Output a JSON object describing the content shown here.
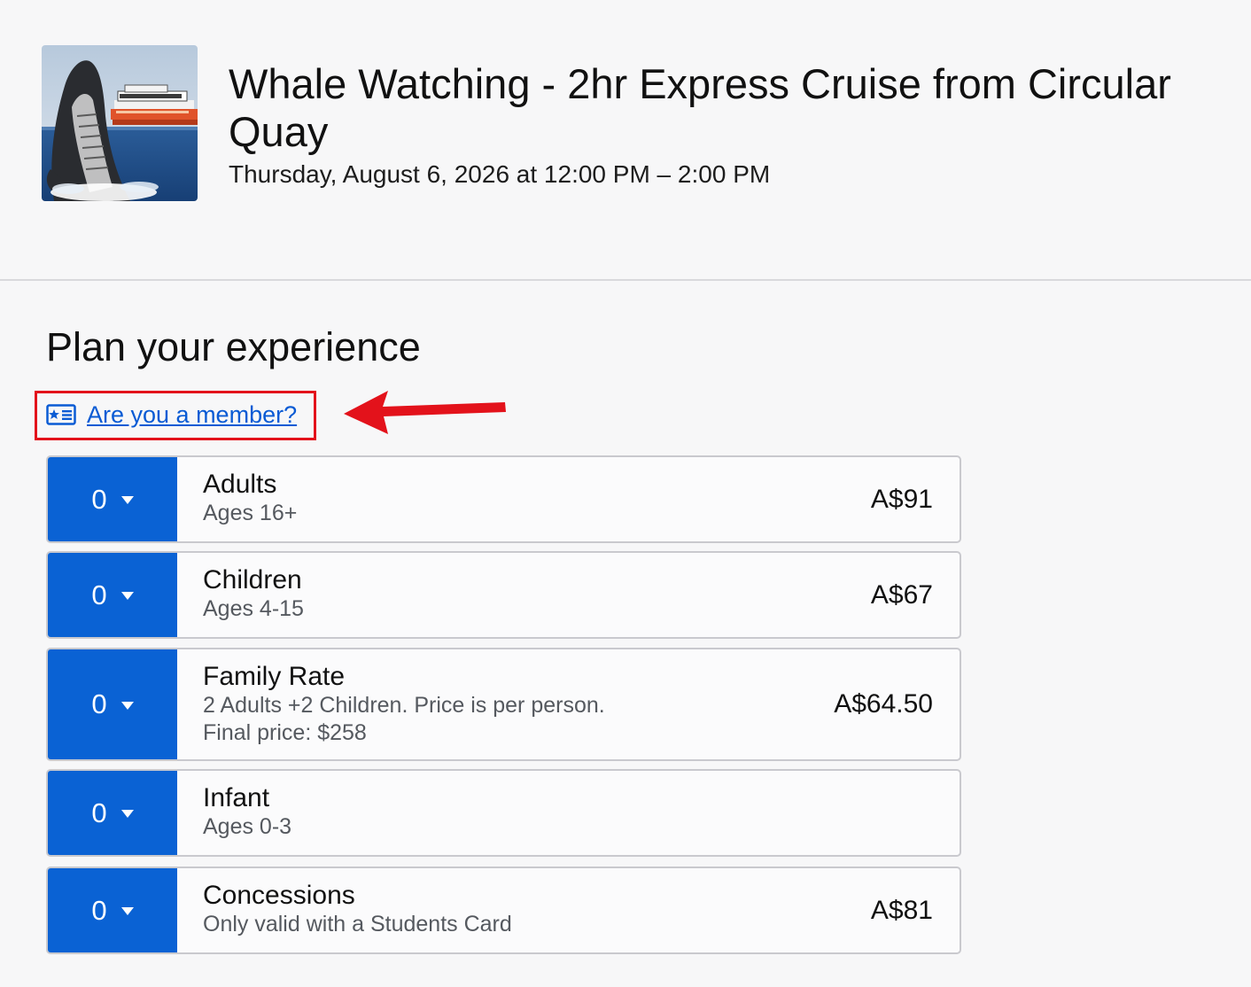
{
  "event": {
    "image_alt": "Whale breaching next to a cruise boat",
    "title": "Whale Watching - 2hr Express Cruise from Circular Quay",
    "datetime": "Thursday, August 6, 2026 at 12:00 PM – 2:00 PM"
  },
  "plan": {
    "heading": "Plan your experience",
    "member_link": "Are you a member?",
    "member_icon": "member-card-icon",
    "highlight_color": "#e3121b"
  },
  "tickets": [
    {
      "qty": "0",
      "name": "Adults",
      "desc": [
        "Ages 16+"
      ],
      "price": "A$91"
    },
    {
      "qty": "0",
      "name": "Children",
      "desc": [
        "Ages 4-15"
      ],
      "price": "A$67"
    },
    {
      "qty": "0",
      "name": "Family Rate",
      "desc": [
        "2 Adults +2 Children. Price is per person.",
        "Final price: $258"
      ],
      "price": "A$64.50"
    },
    {
      "qty": "0",
      "name": "Infant",
      "desc": [
        "Ages 0-3"
      ],
      "price": ""
    },
    {
      "qty": "0",
      "name": "Concessions",
      "desc": [
        "Only valid with a Students Card"
      ],
      "price": "A$81"
    }
  ],
  "colors": {
    "accent": "#0a62d4",
    "link": "#0a5bd4"
  }
}
